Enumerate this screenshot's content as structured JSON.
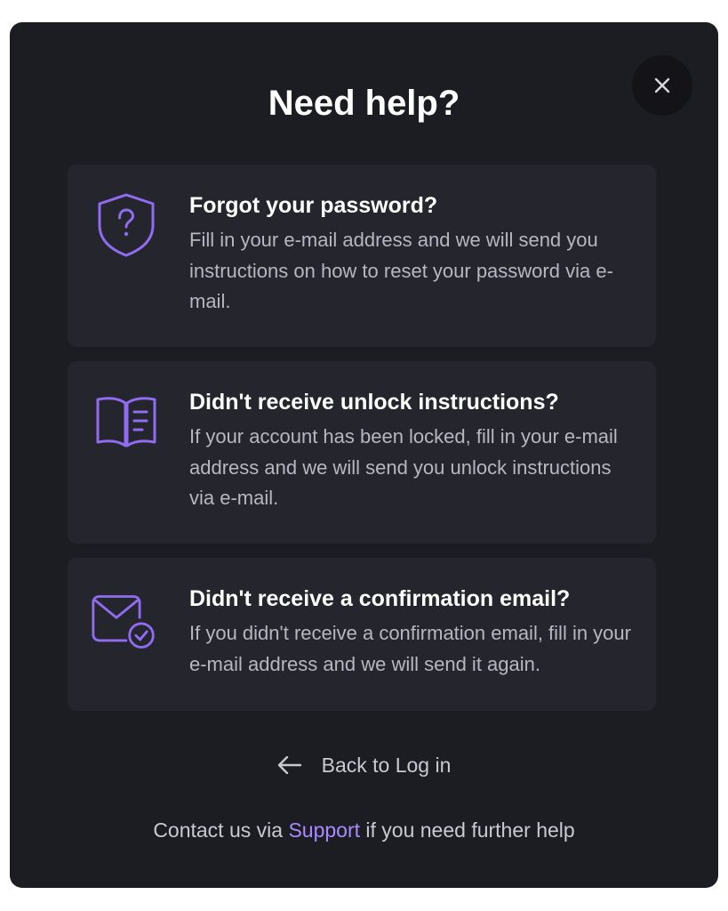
{
  "dialog": {
    "title": "Need help?",
    "close_icon": "close-icon"
  },
  "cards": [
    {
      "icon": "shield-question-icon",
      "title": "Forgot your password?",
      "description": "Fill in your e-mail address and we will send you instructions on how to reset your password via e-mail."
    },
    {
      "icon": "book-open-icon",
      "title": "Didn't receive unlock instructions?",
      "description": "If your account has been locked, fill in your e-mail address and we will send you unlock instructions via e-mail."
    },
    {
      "icon": "mail-check-icon",
      "title": "Didn't receive a confirmation email?",
      "description": "If you didn't receive a confirmation email, fill in your e-mail address and we will send it again."
    }
  ],
  "back": {
    "label": "Back to Log in",
    "icon": "arrow-left-icon"
  },
  "footer": {
    "prefix": "Contact us via",
    "link": "Support",
    "suffix": "if you need further help"
  },
  "colors": {
    "background": "#1c1c23",
    "card": "#25252e",
    "accent": "#a98bff",
    "icon_accent": "#8f6cf0"
  }
}
